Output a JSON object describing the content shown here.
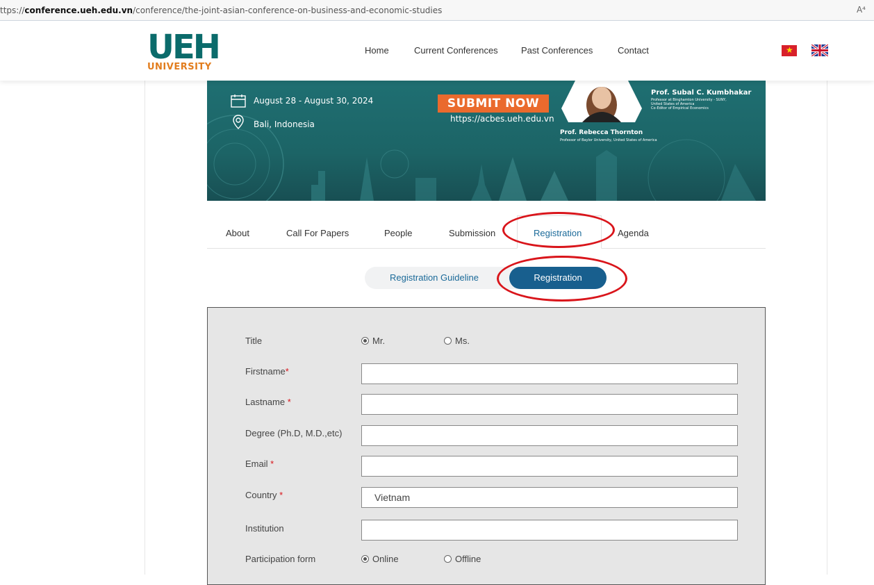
{
  "browser": {
    "url_prefix": "ttps://",
    "url_host": "conference.ueh.edu.vn",
    "url_path": "/conference/the-joint-asian-conference-on-business-and-economic-studies",
    "read_aloud_icon": "A⁴"
  },
  "header": {
    "logo_main": "UEH",
    "logo_sub": "UNIVERSITY",
    "nav": [
      "Home",
      "Current Conferences",
      "Past Conferences",
      "Contact"
    ],
    "flags": [
      "vietnam-flag-icon",
      "uk-flag-icon"
    ]
  },
  "banner": {
    "date": "August 28 - August 30, 2024",
    "location": "Bali, Indonesia",
    "submit": "SUBMIT NOW",
    "website": "https://acbes.ueh.edu.vn",
    "speaker1_name": "Prof. Subal C. Kumbhakar",
    "speaker1_desc1": "Professor at Binghamton University - SUNY,",
    "speaker1_desc2": "United States of America",
    "speaker1_desc3": "Co-Editor of Empirical Economics",
    "speaker2_name": "Prof. Rebecca Thornton",
    "speaker2_desc": "Professor of Baylor University, United States of America"
  },
  "tabs": [
    {
      "label": "About"
    },
    {
      "label": "Call For Papers"
    },
    {
      "label": "People"
    },
    {
      "label": "Submission"
    },
    {
      "label": "Registration",
      "active": true
    },
    {
      "label": "Agenda"
    }
  ],
  "subtabs": {
    "guideline": "Registration Guideline",
    "registration": "Registration"
  },
  "form": {
    "title_label": "Title",
    "title_options": [
      "Mr.",
      "Ms."
    ],
    "title_selected": "Mr.",
    "firstname_label": "Firstname",
    "lastname_label": "Lastname",
    "degree_label": "Degree (Ph.D, M.D.,etc)",
    "email_label": "Email",
    "country_label": "Country",
    "country_value": "Vietnam",
    "institution_label": "Institution",
    "participation_label": "Participation form",
    "participation_options": [
      "Online",
      "Offline"
    ],
    "participation_selected": "Online",
    "required_mark": "*"
  },
  "colors": {
    "brand_teal": "#0b6b6b",
    "brand_orange": "#e27d1e",
    "active_blue": "#185f8e",
    "annotation_red": "#d9151b"
  }
}
